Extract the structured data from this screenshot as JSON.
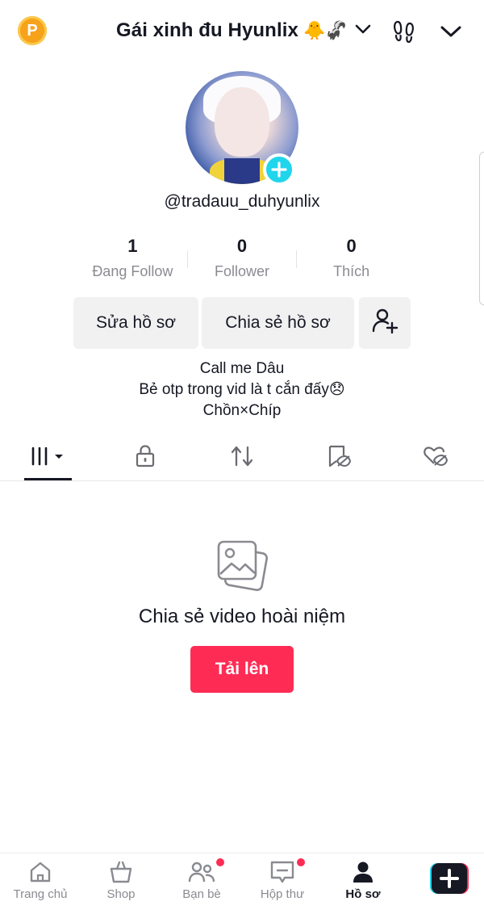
{
  "header": {
    "title": "Gái xinh đu Hyunlix",
    "title_emoji": "🐥🦨",
    "coin_label": "P"
  },
  "profile": {
    "username": "@tradauu_duhyunlix",
    "stats": [
      {
        "value": "1",
        "label": "Đang Follow"
      },
      {
        "value": "0",
        "label": "Follower"
      },
      {
        "value": "0",
        "label": "Thích"
      }
    ],
    "edit_button": "Sửa hồ sơ",
    "share_button": "Chia sẻ hồ sơ",
    "bio": [
      "Call me Dâu",
      "Bẻ otp trong vid là t cắn đấy😞",
      "Chồn×Chíp"
    ]
  },
  "tabs": [
    {
      "icon": "grid-videos-icon",
      "active": true
    },
    {
      "icon": "lock-icon",
      "active": false
    },
    {
      "icon": "repost-icon",
      "active": false
    },
    {
      "icon": "bookmark-hidden-icon",
      "active": false
    },
    {
      "icon": "heart-hidden-icon",
      "active": false
    }
  ],
  "empty_state": {
    "title": "Chia sẻ video hoài niệm",
    "button": "Tải lên"
  },
  "bottom_nav": [
    {
      "label": "Trang chủ",
      "icon": "home-icon",
      "badge": false
    },
    {
      "label": "Shop",
      "icon": "shop-bag-icon",
      "badge": false
    },
    {
      "label": "Bạn bè",
      "icon": "friends-icon",
      "badge": true
    },
    {
      "label": "Hộp thư",
      "icon": "inbox-icon",
      "badge": true
    },
    {
      "label": "Hồ sơ",
      "icon": "profile-icon",
      "badge": false,
      "active": true
    }
  ],
  "colors": {
    "accent": "#fe2c55",
    "cyan": "#20d5ec",
    "text": "#161823",
    "secondary": "#8a8b91"
  }
}
